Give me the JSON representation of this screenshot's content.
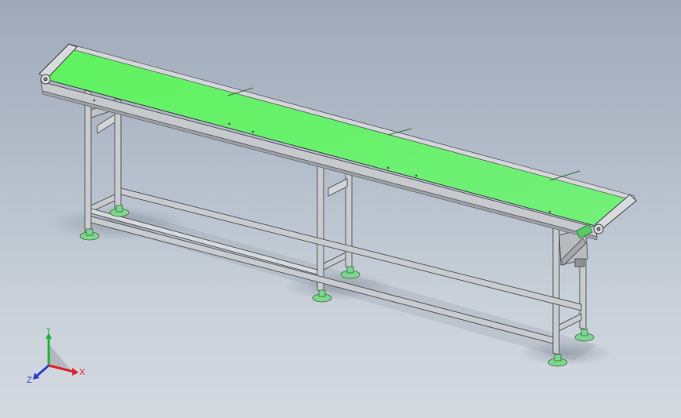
{
  "viewport": {
    "background_top": "#9fa9b8",
    "background_bottom": "#d5dae1"
  },
  "model": {
    "subject": "belt conveyor",
    "belt_color": "#66f266",
    "frame_color": "#c4c6ca",
    "foot_color": "#7fd58f"
  },
  "triad": {
    "x_label": "X",
    "y_label": "Y",
    "z_label": "Z",
    "x_color": "#e0202a",
    "y_color": "#22b33a",
    "z_color": "#2a3fd6"
  }
}
